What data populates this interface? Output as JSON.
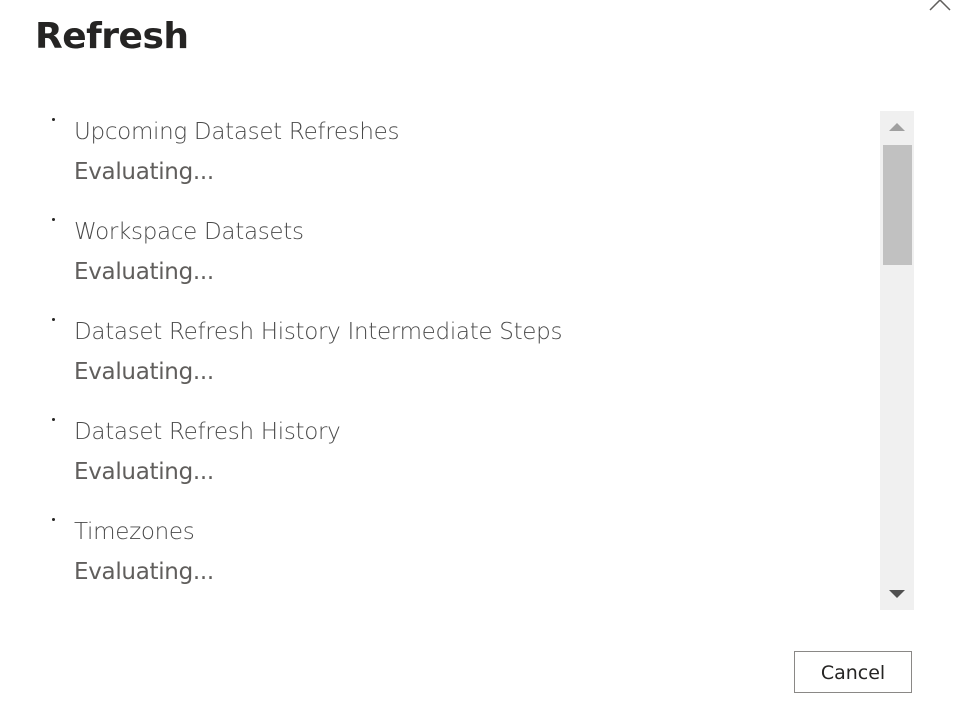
{
  "dialog": {
    "title": "Refresh",
    "close_icon": "close-icon"
  },
  "items": [
    {
      "name": "Upcoming Dataset Refreshes",
      "status": "Evaluating..."
    },
    {
      "name": "Workspace Datasets",
      "status": "Evaluating..."
    },
    {
      "name": "Dataset Refresh History Intermediate Steps",
      "status": "Evaluating..."
    },
    {
      "name": "Dataset Refresh History",
      "status": "Evaluating..."
    },
    {
      "name": "Timezones",
      "status": "Evaluating..."
    }
  ],
  "scrollbar": {
    "up_icon": "triangle-up-icon",
    "down_icon": "triangle-down-icon"
  },
  "footer": {
    "cancel_label": "Cancel"
  }
}
